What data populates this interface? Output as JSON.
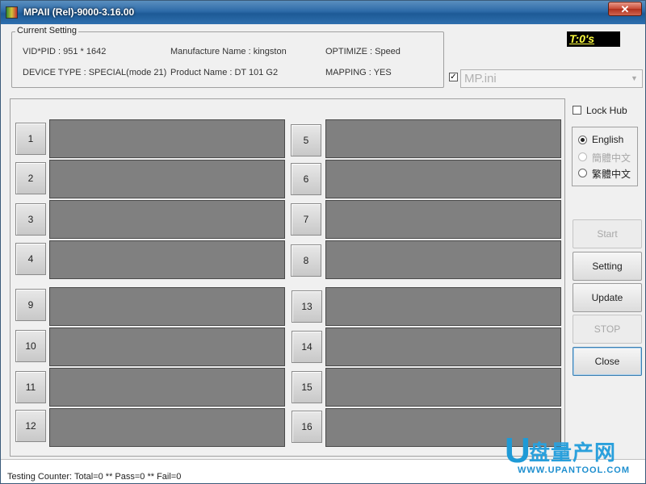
{
  "window": {
    "title": "MPAII (Rel)-9000-3.16.00",
    "close_label": "✕"
  },
  "current_setting": {
    "legend": "Current Setting",
    "vid_pid": "VID*PID :  951 * 1642",
    "manufacture": "Manufacture Name : kingston",
    "optimize": "OPTIMIZE : Speed",
    "device_type": "DEVICE TYPE : SPECIAL(mode 21)",
    "product": "Product Name : DT 101 G2",
    "mapping": "MAPPING : YES"
  },
  "timer": {
    "text": "T:0's"
  },
  "ini": {
    "checked": true,
    "value": "MP.ini"
  },
  "slots": {
    "left_top": [
      "1",
      "2",
      "3",
      "4"
    ],
    "right_top": [
      "5",
      "6",
      "7",
      "8"
    ],
    "left_bottom": [
      "9",
      "10",
      "11",
      "12"
    ],
    "right_bottom": [
      "13",
      "14",
      "15",
      "16"
    ]
  },
  "lock_hub": {
    "label": "Lock Hub",
    "checked": false
  },
  "language": {
    "english": "English",
    "simplified": "簡體中文",
    "traditional": "繁體中文",
    "selected": "english"
  },
  "buttons": {
    "start": "Start",
    "setting": "Setting",
    "update": "Update",
    "stop": "STOP",
    "close": "Close"
  },
  "status": {
    "text": "Testing Counter: Total=0 ** Pass=0 ** Fail=0"
  },
  "watermark": {
    "letter": "U",
    "cn": "盘量产网",
    "url": "WWW.UPANTOOL.COM"
  },
  "colors": {
    "title_bar": "#2d6aa8",
    "slot_bar": "#808080",
    "timer_bg": "#000000",
    "timer_fg": "#ffff40",
    "watermark": "#1e9ad6"
  },
  "icons": [
    "app-icon",
    "close-icon"
  ]
}
